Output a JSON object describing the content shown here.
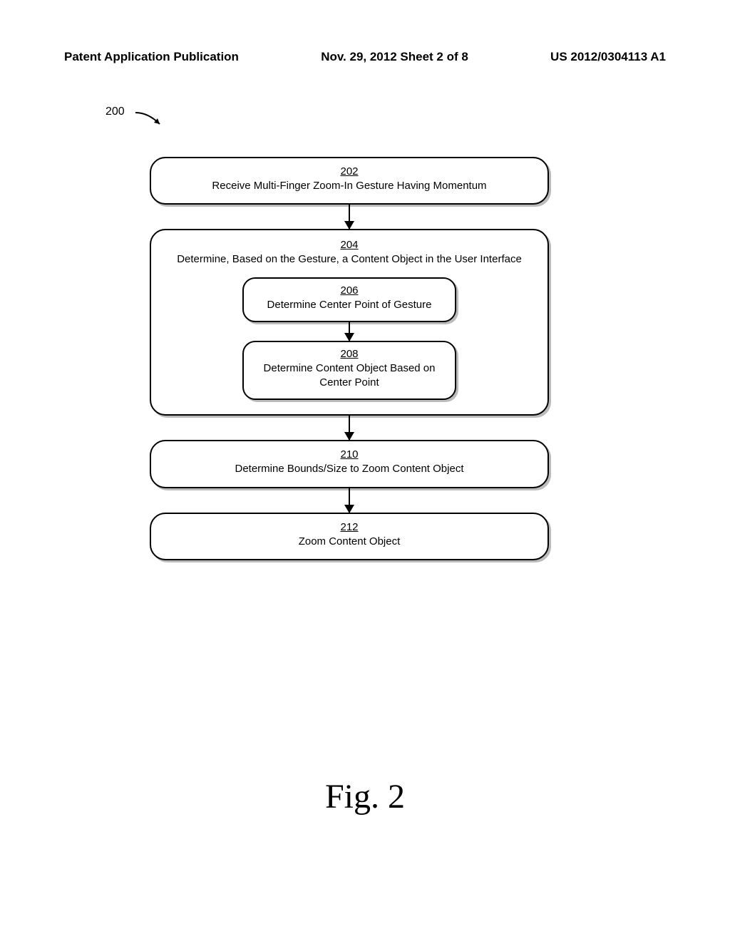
{
  "header": {
    "left": "Patent Application Publication",
    "center": "Nov. 29, 2012  Sheet 2 of 8",
    "right": "US 2012/0304113 A1"
  },
  "ref": "200",
  "steps": {
    "s202": {
      "num": "202",
      "text": "Receive Multi-Finger Zoom-In Gesture Having Momentum"
    },
    "s204": {
      "num": "204",
      "text": "Determine, Based on the Gesture, a Content Object in the User Interface"
    },
    "s206": {
      "num": "206",
      "text": "Determine Center Point of Gesture"
    },
    "s208": {
      "num": "208",
      "text": "Determine Content Object Based on Center Point"
    },
    "s210": {
      "num": "210",
      "text": "Determine Bounds/Size to Zoom Content Object"
    },
    "s212": {
      "num": "212",
      "text": "Zoom Content Object"
    }
  },
  "figure_label": "Fig. 2"
}
